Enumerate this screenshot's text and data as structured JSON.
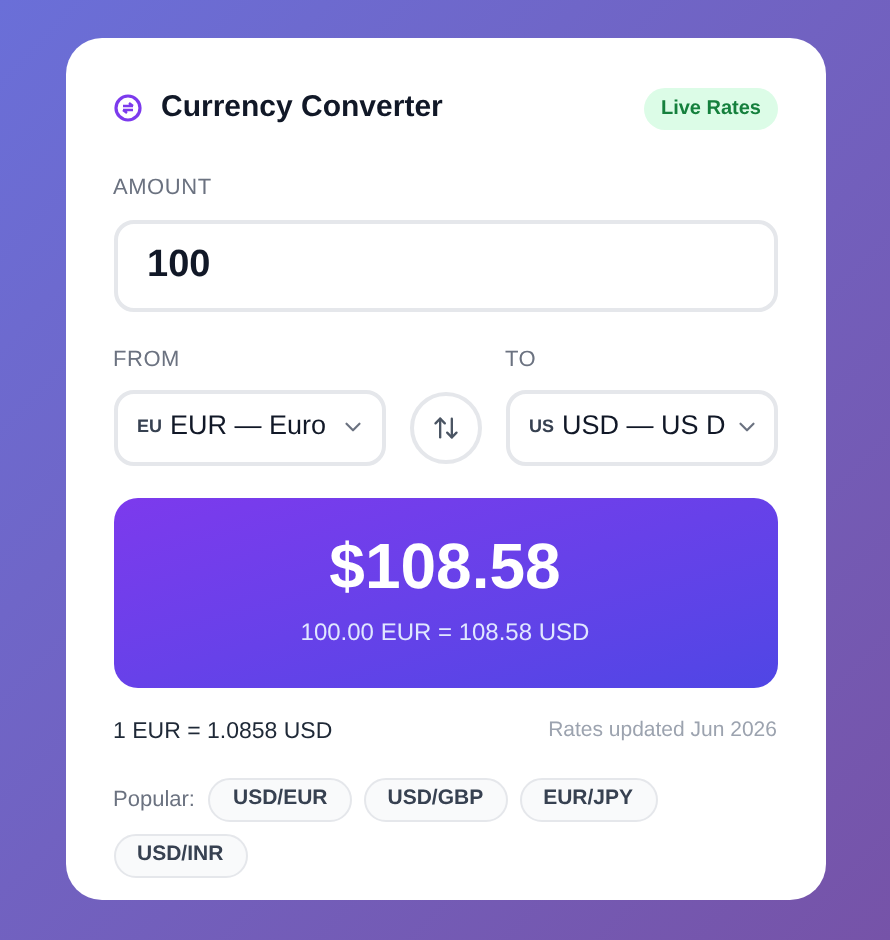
{
  "header": {
    "title": "Currency Converter",
    "badge": "Live Rates"
  },
  "amount": {
    "label": "AMOUNT",
    "value": "100"
  },
  "from": {
    "label": "FROM",
    "flag": "EU",
    "value": "EUR — Euro"
  },
  "to": {
    "label": "TO",
    "flag": "US",
    "value": "USD — US D"
  },
  "result": {
    "value": "$108.58",
    "detail": "100.00 EUR = 108.58 USD"
  },
  "rate": "1 EUR = 1.0858 USD",
  "updated": "Rates updated Jun 2026",
  "popular": {
    "label": "Popular:",
    "pairs": [
      "USD/EUR",
      "USD/GBP",
      "EUR/JPY",
      "USD/INR"
    ]
  }
}
